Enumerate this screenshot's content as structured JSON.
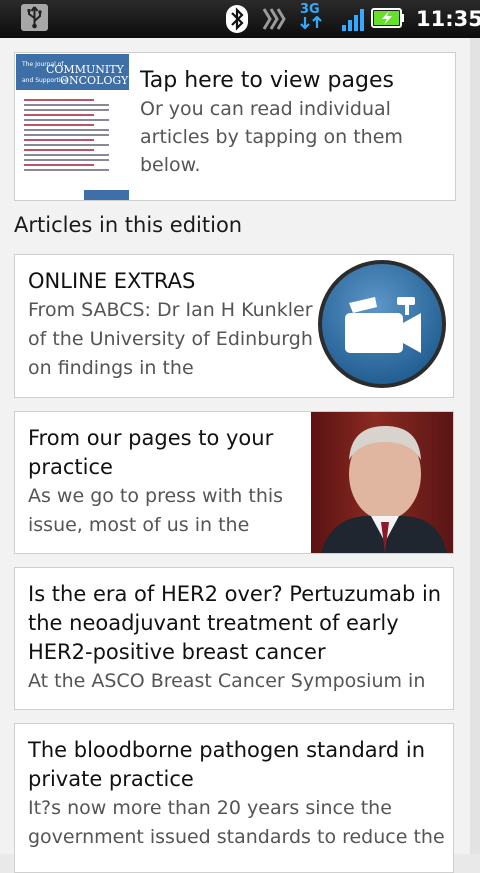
{
  "status_bar": {
    "network_type": "3G",
    "time": "11:35"
  },
  "cover": {
    "title": "Tap here to view pages",
    "subtitle": "Or you can read individual articles by tapping on them below.",
    "journal_line1": "The Journal of",
    "journal_name1": "COMMUNITY",
    "journal_line2": "and Supportive",
    "journal_name2": "ONCOLOGY"
  },
  "section_title": "Articles in this edition",
  "articles": [
    {
      "title": "ONLINE EXTRAS",
      "excerpt": "From SABCS: Dr Ian H Kunkler of the University of Edinburgh on findings in the",
      "thumbnail": "video-camera-icon"
    },
    {
      "title": "From our pages to your practice",
      "excerpt": "As we go to press with this issue, most of us in the",
      "thumbnail": "author-photo"
    },
    {
      "title": "Is the era of HER2 over? Pertuzumab in the neoadjuvant treatment of early HER2-positive breast cancer",
      "excerpt": "At the ASCO Breast Cancer Symposium in"
    },
    {
      "title": "The bloodborne pathogen standard in private practice",
      "excerpt": "It?s now more than 20 years since the government issued standards to reduce the"
    }
  ],
  "colors": {
    "accent_blue": "#1f5f93",
    "status_bar": "#1a1a1a",
    "network_blue": "#35a8ff",
    "battery_green": "#66e02b"
  }
}
